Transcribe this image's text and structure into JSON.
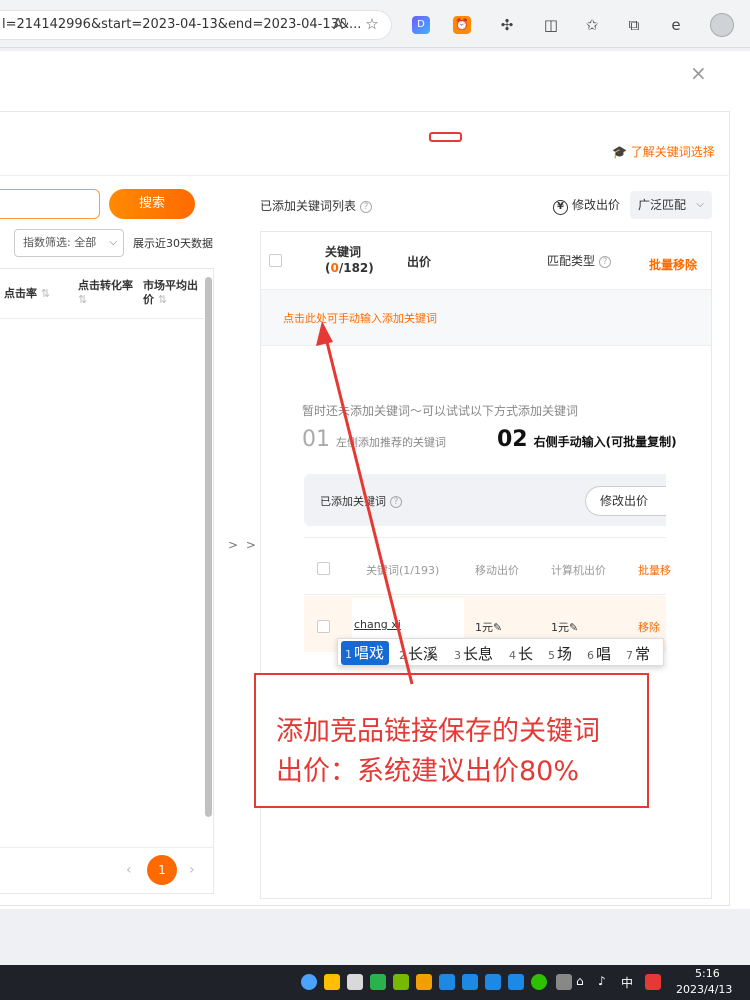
{
  "browser": {
    "url": "l=214142996&start=2023-04-13&end=2023-04-13&...",
    "read_aloud_icon": "A⁾"
  },
  "modal": {
    "close_label": "×",
    "learn_link": "🎓 了解关键词选择"
  },
  "left": {
    "search_button": "搜索",
    "filter_select": "指数筛选: 全部",
    "days_text": "展示近30天数据",
    "columns": {
      "click_rate": "点击率",
      "conversion_rate_1": "点击转化率",
      "market_avg_1": "市场平均出",
      "market_avg_2": "价"
    },
    "sort_icon": "⇅",
    "pagination": {
      "prev": "‹",
      "current": "1",
      "next": "›"
    }
  },
  "transfer_arrow": "> >",
  "right": {
    "title": "已添加关键词列表",
    "modify_price": "修改出价",
    "match_select": "广泛匹配",
    "columns": {
      "keyword": "关键词",
      "keyword_count_open": "(",
      "keyword_count_current": "0",
      "keyword_count_rest": "/182)",
      "price": "出价",
      "match_type": "匹配类型",
      "batch_remove": "批量移除"
    },
    "manual_input_link": "点击此处可手动输入添加关键词",
    "empty_tip": "暂时还未添加关键词～可以试试以下方式添加关键词",
    "step1_num": "01",
    "step1_text": "左侧添加推荐的关键词",
    "step2_num": "02",
    "step2_text": "右侧手动输入(可批量复制)"
  },
  "inner": {
    "title": "已添加关键词",
    "modify_button": "修改出价",
    "columns": {
      "keyword": "关键词(1/193)",
      "mobile_price": "移动出价",
      "pc_price": "计算机出价",
      "batch": "批量移"
    },
    "row": {
      "keyword": "chang xi",
      "mobile_price": "1元✎",
      "pc_price": "1元✎",
      "remove": "移除"
    }
  },
  "ime": {
    "candidates": [
      {
        "n": "1",
        "w": "唱戏"
      },
      {
        "n": "2",
        "w": "长溪"
      },
      {
        "n": "3",
        "w": "长息"
      },
      {
        "n": "4",
        "w": "长"
      },
      {
        "n": "5",
        "w": "场"
      },
      {
        "n": "6",
        "w": "唱"
      },
      {
        "n": "7",
        "w": "常"
      }
    ]
  },
  "annotation": {
    "line1": "添加竞品链接保存的关键词",
    "line2": "出价：系统建议出价80%"
  },
  "taskbar": {
    "ime_mode": "中",
    "time": "5:16",
    "date": "2023/4/13"
  },
  "colors": {
    "accent": "#ff6a00",
    "annotation_red": "#e53935",
    "ime_selected": "#1769d3"
  }
}
